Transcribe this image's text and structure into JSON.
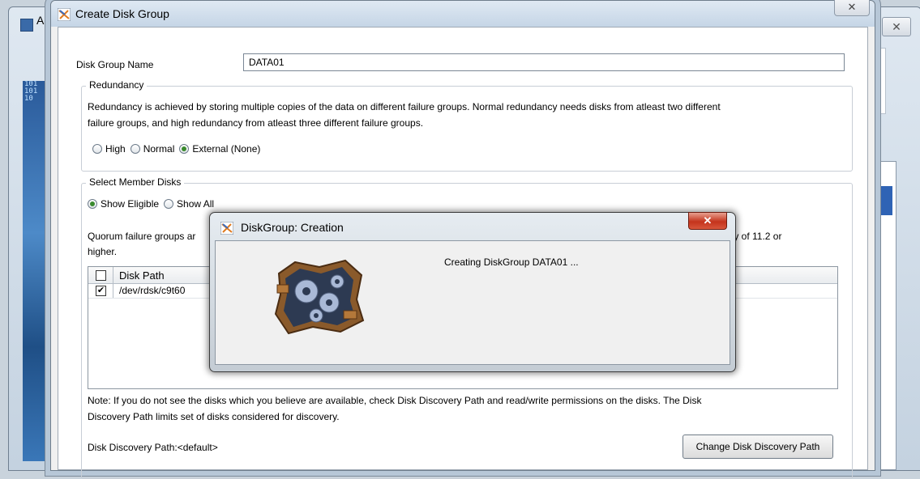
{
  "background_window": {
    "title": "A",
    "close_glyph": "✕"
  },
  "dialog": {
    "title": "Create Disk Group",
    "close_glyph": "✕",
    "disk_group_name_label": "Disk Group Name",
    "disk_group_name_value": "DATA01",
    "redundancy": {
      "legend": "Redundancy",
      "description_line1": "Redundancy is achieved by storing multiple copies of the data on different failure groups. Normal redundancy needs disks from atleast two different",
      "description_line2": "failure groups, and high redundancy from atleast three different failure groups.",
      "options": [
        {
          "label": "High",
          "selected": false
        },
        {
          "label": "Normal",
          "selected": false
        },
        {
          "label": "External (None)",
          "selected": true
        }
      ]
    },
    "member_disks": {
      "legend": "Select Member Disks",
      "options": [
        {
          "label": "Show Eligible",
          "selected": true
        },
        {
          "label": "Show All",
          "selected": false
        }
      ],
      "quorum_text_start": "Quorum failure groups ar",
      "quorum_text_end": "ility of 11.2 or",
      "quorum_text_line2": "higher.",
      "table": {
        "header_checked": false,
        "columns": [
          "Disk Path"
        ],
        "rows": [
          {
            "checked": true,
            "disk_path": "/dev/rdsk/c9t60"
          }
        ]
      },
      "note_line1": "Note: If you do not see the disks which you believe are available, check Disk Discovery Path and read/write permissions on the disks. The Disk",
      "note_line2": "Discovery Path limits set of disks considered for discovery.",
      "discovery_path_label": "Disk Discovery Path:<default>",
      "change_discovery_button": "Change Disk Discovery Path"
    }
  },
  "modal": {
    "title": "DiskGroup: Creation",
    "close_glyph": "✕",
    "message": "Creating DiskGroup DATA01 ...",
    "icon": "gears-icon"
  },
  "colors": {
    "accent": "#2f63b5",
    "close_red": "#c4331c",
    "radio_on": "#3a8a2e"
  }
}
